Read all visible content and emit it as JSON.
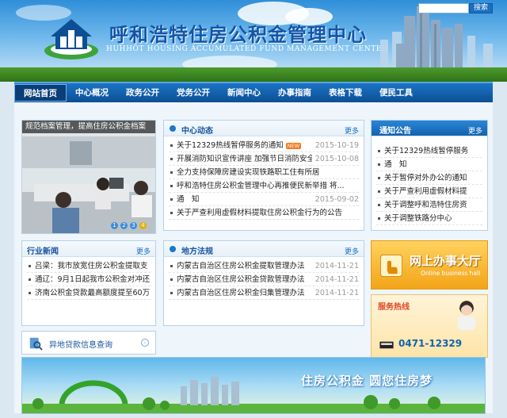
{
  "header": {
    "title": "呼和浩特住房公积金管理中心",
    "subtitle": "HUHHOT HOUSING ACCUMULATED FUND MANAGEMENT CENTER",
    "search_button": "搜索"
  },
  "nav": {
    "items": [
      "网站首页",
      "中心概况",
      "政务公开",
      "党务公开",
      "新闻中心",
      "办事指南",
      "表格下载",
      "便民工具"
    ]
  },
  "photo": {
    "caption": "规范档案管理，提高住房公积金档案",
    "dots": [
      "1",
      "2",
      "3",
      "4"
    ]
  },
  "center_news": {
    "title": "中心动态",
    "more": "更多",
    "hot_badge": "NEW",
    "items": [
      {
        "text": "关于12329热线暂停服务的通知",
        "date": "2015-10-19"
      },
      {
        "text": "开展消防知识宣传讲座 加强节日消防安全",
        "date": "2015-10-08"
      },
      {
        "text": "全力支持保障房建设实现铁路职工住有所居",
        "date": ""
      },
      {
        "text": "呼和浩特住房公积金管理中心再推便民新举措 将...",
        "date": ""
      },
      {
        "text": "通　知",
        "date": "2015-09-02"
      },
      {
        "text": "关于严查利用虚假材料提取住房公积金行为的公告",
        "date": ""
      }
    ]
  },
  "notice": {
    "title": "通知公告",
    "more": "更多",
    "items": [
      "关于12329热线暂停服务",
      "通　知",
      "关于暂停对外办公的通知",
      "关于严查利用虚假材料提",
      "关于调整呼和浩特住房资",
      "关于调整铁路分中心"
    ]
  },
  "industry": {
    "title": "行业新闻",
    "more": "更多",
    "items": [
      "吕梁：我市放宽住房公积金提取支",
      "通辽：9月1日起我市公积金对冲还",
      "济南公积金贷款最高额度提至60万"
    ]
  },
  "laws": {
    "title": "地方法规",
    "more": "更多",
    "items": [
      {
        "text": "内蒙古自治区住房公积金提取管理办法",
        "date": "2014-11-21"
      },
      {
        "text": "内蒙古自治区住房公积金贷款管理办法",
        "date": "2014-11-21"
      },
      {
        "text": "内蒙古自治区住房公积金归集管理办法",
        "date": "2014-11-21"
      }
    ]
  },
  "loan_query": {
    "label": "异地贷款信息查询"
  },
  "online_service": {
    "title": "网上办事大厅",
    "subtitle": "Online business hall"
  },
  "hotline": {
    "title": "服务热线",
    "number": "0471-12329"
  },
  "banner": {
    "slogan": "住房公积金 圆您住房梦"
  }
}
